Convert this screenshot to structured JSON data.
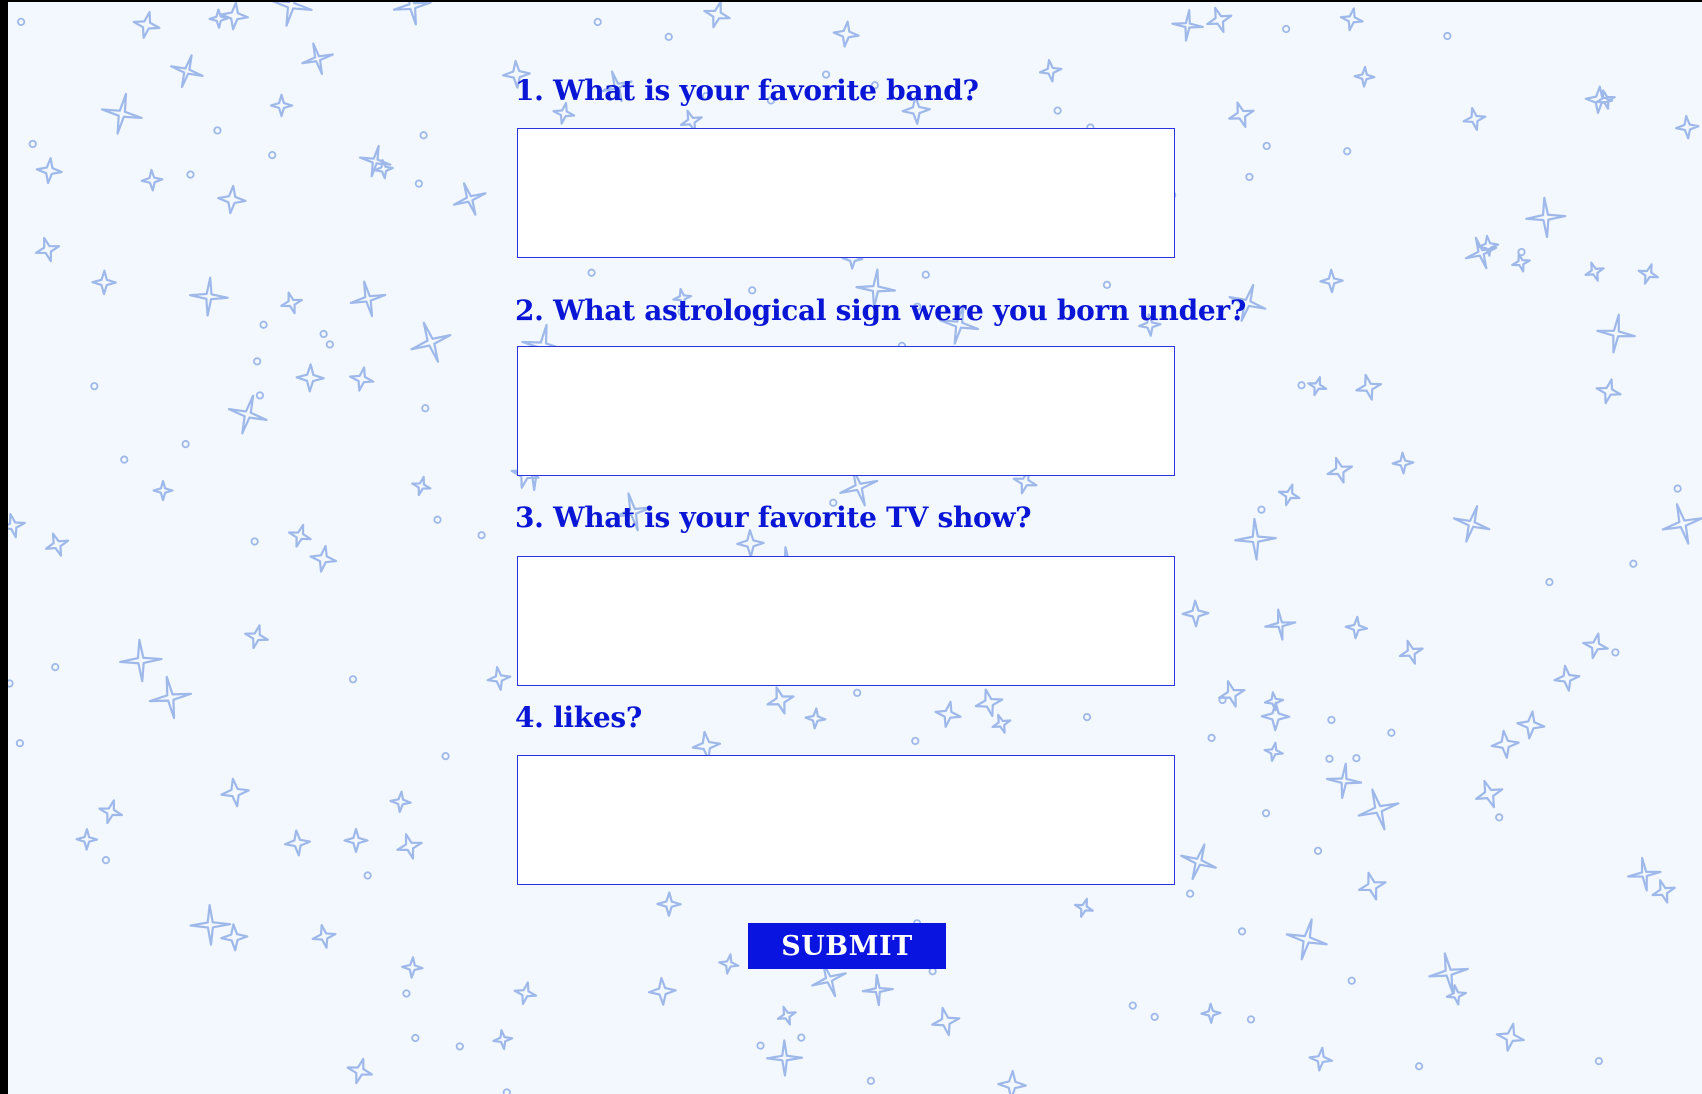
{
  "questions": [
    {
      "label": "1.  What is your favorite band?",
      "value": ""
    },
    {
      "label": "2. What astrological sign were you born under?",
      "value": ""
    },
    {
      "label": "3. What is your favorite TV show?",
      "value": ""
    },
    {
      "label": "4. likes?",
      "value": ""
    }
  ],
  "submit_label": "SUBMIT",
  "colors": {
    "accent": "#0a16d6",
    "background": "#f2f8fe",
    "sparkle": "#9fb8ea"
  },
  "background_icon": "sparkle-star-icon"
}
